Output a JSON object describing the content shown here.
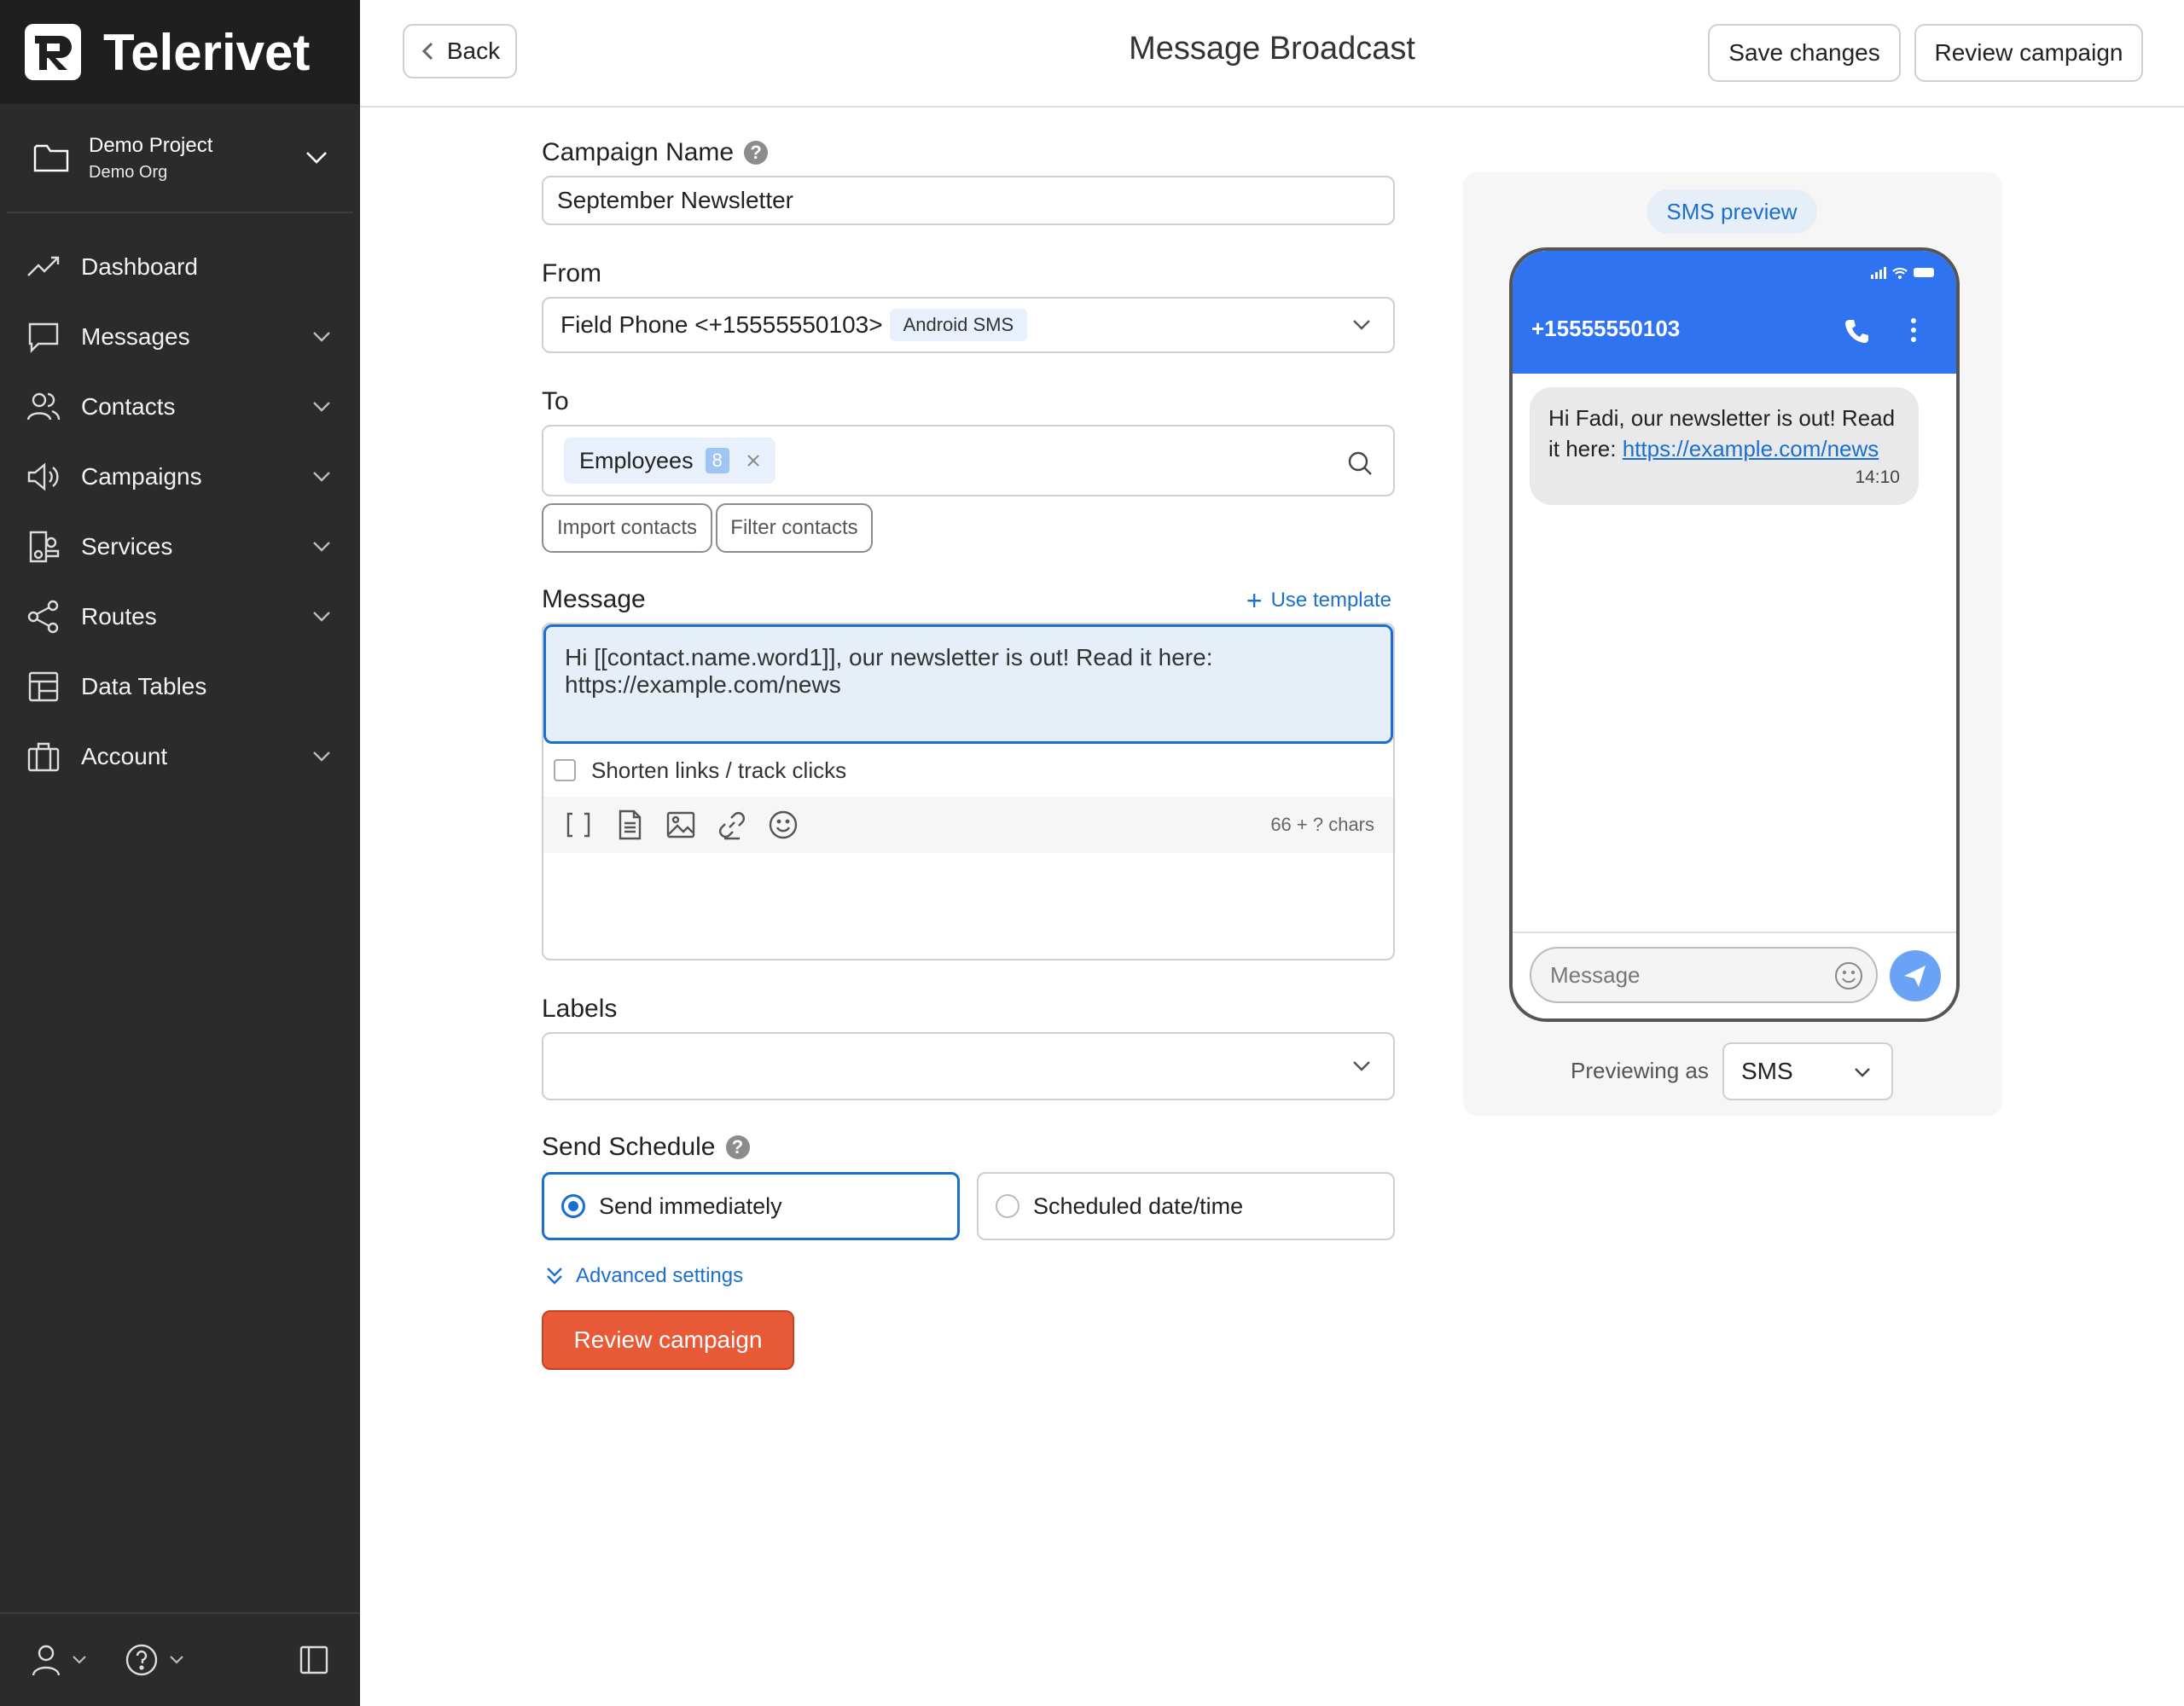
{
  "brand": {
    "name": "Telerivet",
    "accent": "#2f73f0",
    "cta_color": "#e85a37",
    "sidebar_bg": "#2b2b2b"
  },
  "project": {
    "name": "Demo Project",
    "org": "Demo Org"
  },
  "nav": [
    {
      "label": "Dashboard",
      "icon": "trend-icon"
    },
    {
      "label": "Messages",
      "icon": "chat-icon"
    },
    {
      "label": "Contacts",
      "icon": "people-icon"
    },
    {
      "label": "Campaigns",
      "icon": "megaphone-icon"
    },
    {
      "label": "Services",
      "icon": "services-icon"
    },
    {
      "label": "Routes",
      "icon": "share-icon"
    },
    {
      "label": "Data Tables",
      "icon": "table-icon"
    },
    {
      "label": "Account",
      "icon": "briefcase-icon"
    }
  ],
  "header": {
    "back_label": "Back",
    "title": "Message Broadcast",
    "save_label": "Save changes",
    "review_label": "Review campaign"
  },
  "form": {
    "campaign_name_label": "Campaign Name",
    "campaign_name_value": "September Newsletter",
    "from_label": "From",
    "from_value": "Field Phone <+15555550103>",
    "from_tag": "Android SMS",
    "to_label": "To",
    "to_chip": "Employees",
    "to_chip_count": "8",
    "import_label": "Import contacts",
    "filter_label": "Filter contacts",
    "message_label": "Message",
    "use_template_label": "Use template",
    "message_text": "Hi [[contact.name.word1]], our newsletter is out! Read it here: https://example.com/news",
    "shorten_label": "Shorten links / track clicks",
    "shorten_checked": false,
    "char_count": "66 + ? chars",
    "labels_label": "Labels",
    "schedule_label": "Send Schedule",
    "schedule_options": [
      "Send immediately",
      "Scheduled date/time"
    ],
    "schedule_selected": "Send immediately",
    "advanced_label": "Advanced settings",
    "review_label": "Review campaign"
  },
  "preview": {
    "badge": "SMS preview",
    "phone_number": "+15555550103",
    "bubble_text": "Hi Fadi, our newsletter is out! Read it here: ",
    "bubble_link": "https://example.com/news",
    "bubble_time": "14:10",
    "input_placeholder": "Message",
    "previewing_as_label": "Previewing as",
    "previewing_as_value": "SMS"
  }
}
